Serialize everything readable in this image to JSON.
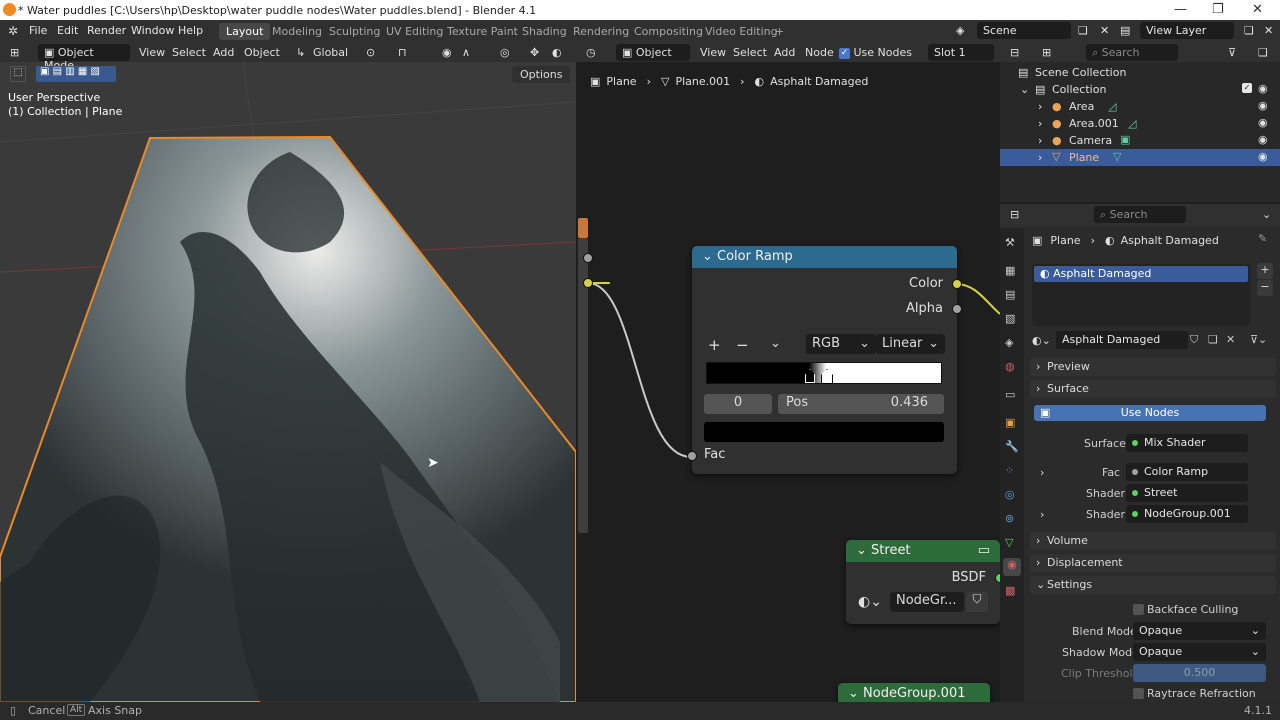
{
  "titlebar": {
    "title": "* Water puddles [C:\\Users\\hp\\Desktop\\water puddle nodes\\Water puddles.blend] - Blender 4.1",
    "minimize": "—",
    "maximize": "❐",
    "close": "✕"
  },
  "menu": {
    "items": [
      "File",
      "Edit",
      "Render",
      "Window",
      "Help"
    ]
  },
  "workspaces": {
    "tabs": [
      "Layout",
      "Modeling",
      "Sculpting",
      "UV Editing",
      "Texture Paint",
      "Shading",
      "Rendering",
      "Compositing",
      "Video Editing"
    ],
    "add": "+",
    "active": "Layout"
  },
  "scene": {
    "scene_name": "Scene",
    "view_layer": "View Layer"
  },
  "viewport": {
    "mode": "Object Mode",
    "menus": [
      "View",
      "Select",
      "Add",
      "Object"
    ],
    "orientation": "Global",
    "options": "Options",
    "overlay_line1": "User Perspective",
    "overlay_line2": "(1) Collection | Plane"
  },
  "node_editor": {
    "type": "Object",
    "menus": [
      "View",
      "Select",
      "Add",
      "Node"
    ],
    "use_nodes": "Use Nodes",
    "slot": "Slot 1",
    "breadcrumb": [
      "Plane",
      "Plane.001",
      "Asphalt Damaged"
    ],
    "color_ramp": {
      "title": "Color Ramp",
      "out_color": "Color",
      "out_alpha": "Alpha",
      "plus": "+",
      "minus": "−",
      "menu": "⌄",
      "color_mode": "RGB",
      "interpolation": "Linear",
      "index": "0",
      "pos_label": "Pos",
      "pos_value": "0.436",
      "in_fac": "Fac"
    },
    "street": {
      "title": "Street",
      "out": "BSDF",
      "group": "NodeGr..."
    },
    "nodegroup": {
      "title": "NodeGroup.001"
    }
  },
  "outliner": {
    "search_placeholder": "Search",
    "scene_collection": "Scene Collection",
    "collection": "Collection",
    "items": [
      "Area",
      "Area.001",
      "Camera",
      "Plane"
    ]
  },
  "properties": {
    "search_placeholder": "Search",
    "breadcrumb_object": "Plane",
    "breadcrumb_material": "Asphalt Damaged",
    "slot_name": "Asphalt Damaged",
    "material_name": "Asphalt Damaged",
    "sections": {
      "preview": "Preview",
      "surface": "Surface",
      "volume": "Volume",
      "displacement": "Displacement",
      "settings": "Settings"
    },
    "use_nodes_button": "Use Nodes",
    "surface_label": "Surface",
    "surface_value": "Mix Shader",
    "fac_label": "Fac",
    "fac_value": "Color Ramp",
    "shader1_label": "Shader",
    "shader1_value": "Street",
    "shader2_label": "Shader",
    "shader2_value": "NodeGroup.001",
    "backface_culling": "Backface Culling",
    "blend_mode_label": "Blend Mode",
    "blend_mode_value": "Opaque",
    "shadow_mode_label": "Shadow Mode",
    "shadow_mode_value": "Opaque",
    "clip_threshold_label": "Clip Threshold",
    "clip_threshold_value": "0.500",
    "raytrace_refraction": "Raytrace Refraction"
  },
  "statusbar": {
    "cancel": "Cancel",
    "alt_key": "Alt",
    "axis_snap": "Axis Snap",
    "version": "4.1.1"
  },
  "colors": {
    "accent_blue": "#3b5c9a",
    "node_header_blue": "#2c6b8f",
    "node_header_green": "#2e6b3a",
    "selection_orange": "#f0a030"
  }
}
